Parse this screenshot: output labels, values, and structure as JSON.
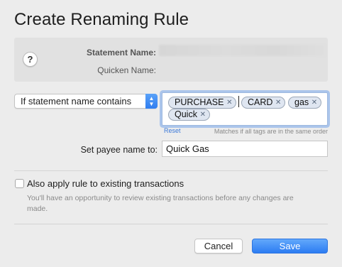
{
  "dialog": {
    "title": "Create Renaming Rule"
  },
  "info": {
    "help_label": "?",
    "statement_name_label": "Statement Name:",
    "quicken_name_label": "Quicken Name:"
  },
  "rule": {
    "condition_selected": "If statement name contains",
    "tags": [
      {
        "label": "PURCHASE"
      },
      {
        "label": "CARD"
      },
      {
        "label": "gas"
      },
      {
        "label": "Quick"
      }
    ],
    "reset_link": "Reset",
    "hint": "Matches if all tags are in the same order"
  },
  "payee": {
    "label": "Set payee name to:",
    "value": "Quick Gas"
  },
  "apply_existing": {
    "label": "Also apply rule to existing transactions",
    "checked": false,
    "note": "You'll have an opportunity to review existing transactions before any changes are made."
  },
  "buttons": {
    "cancel": "Cancel",
    "save": "Save"
  },
  "colors": {
    "accent": "#2f7df0",
    "link": "#3b79d9"
  },
  "icons": {
    "help": "question-mark-icon",
    "tag_remove": "close-icon",
    "select_stepper": "chevron-updown-icon"
  }
}
